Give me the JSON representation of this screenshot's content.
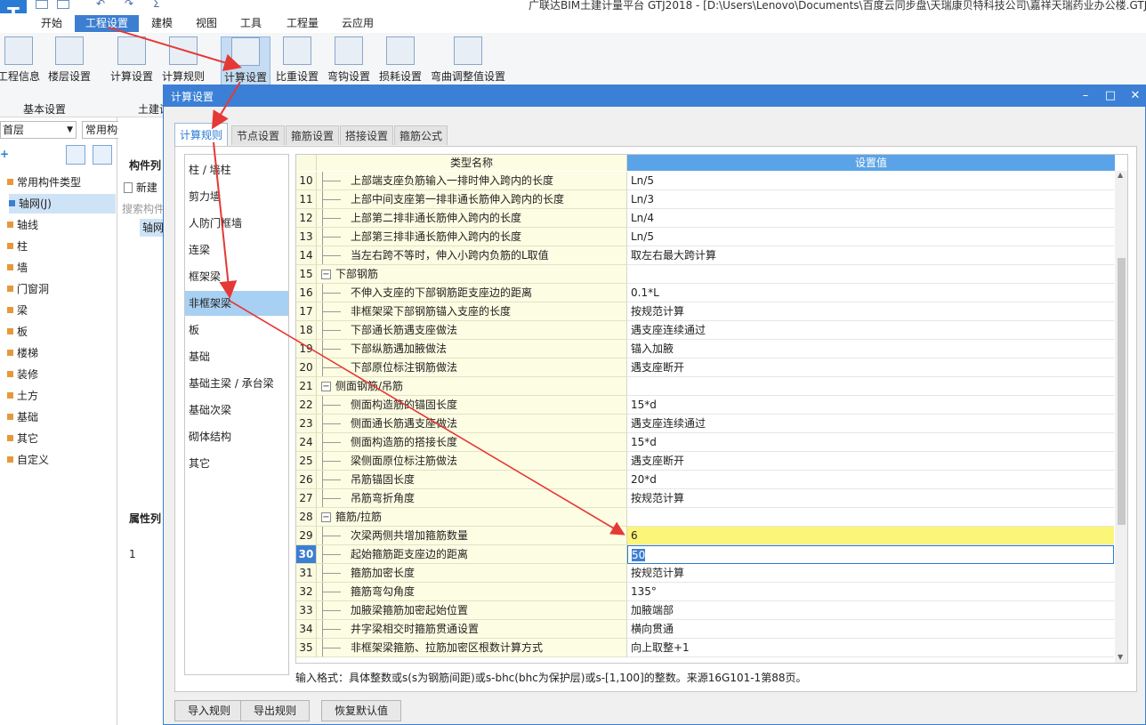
{
  "app_title": "广联达BIM土建计量平台 GTJ2018 - [D:\\Users\\Lenovo\\Documents\\百度云同步盘\\天瑞康贝特科技公司\\嘉祥天瑞药业办公楼.GTJ]",
  "menu_tabs": [
    "开始",
    "工程设置",
    "建模",
    "视图",
    "工具",
    "工程量",
    "云应用"
  ],
  "ribbon": {
    "buttons": [
      "工程信息",
      "楼层设置",
      "计算设置",
      "计算规则",
      "计算设置",
      "比重设置",
      "弯钩设置",
      "损耗设置",
      "弯曲调整值设置"
    ],
    "groups": [
      "基本设置",
      "土建设"
    ]
  },
  "left_pane": {
    "floor_select": "首层",
    "type_select": "常用构件类型",
    "tree": [
      "常用构件类型",
      "轴网(J)",
      "轴线",
      "柱",
      "墙",
      "门窗洞",
      "梁",
      "板",
      "楼梯",
      "装修",
      "土方",
      "基础",
      "其它",
      "自定义"
    ]
  },
  "mid_pane": {
    "title": "构件列",
    "new_label": "新建",
    "search_placeholder": "搜索构件",
    "item": "轴网",
    "props_title": "属性列",
    "props_row": "1"
  },
  "dialog": {
    "title": "计算设置",
    "tabs": [
      "计算规则",
      "节点设置",
      "箍筋设置",
      "搭接设置",
      "箍筋公式"
    ],
    "categories": [
      "柱 / 墙柱",
      "剪力墙",
      "人防门框墙",
      "连梁",
      "框架梁",
      "非框架梁",
      "板",
      "基础",
      "基础主梁 / 承台梁",
      "基础次梁",
      "砌体结构",
      "其它"
    ],
    "grid_headers": [
      "类型名称",
      "设置值"
    ],
    "rows": [
      {
        "no": "10",
        "name": "上部端支座负筋输入一排时伸入跨内的长度",
        "value": "Ln/5"
      },
      {
        "no": "11",
        "name": "上部中间支座第一排非通长筋伸入跨内的长度",
        "value": "Ln/3"
      },
      {
        "no": "12",
        "name": "上部第二排非通长筋伸入跨内的长度",
        "value": "Ln/4"
      },
      {
        "no": "13",
        "name": "上部第三排非通长筋伸入跨内的长度",
        "value": "Ln/5"
      },
      {
        "no": "14",
        "name": "当左右跨不等时，伸入小跨内负筋的L取值",
        "value": "取左右最大跨计算"
      },
      {
        "no": "15",
        "name": "下部钢筋",
        "value": "",
        "group": true
      },
      {
        "no": "16",
        "name": "不伸入支座的下部钢筋距支座边的距离",
        "value": "0.1*L"
      },
      {
        "no": "17",
        "name": "非框架梁下部钢筋锚入支座的长度",
        "value": "按规范计算"
      },
      {
        "no": "18",
        "name": "下部通长筋遇支座做法",
        "value": "遇支座连续通过"
      },
      {
        "no": "19",
        "name": "下部纵筋遇加腋做法",
        "value": "锚入加腋"
      },
      {
        "no": "20",
        "name": "下部原位标注钢筋做法",
        "value": "遇支座断开"
      },
      {
        "no": "21",
        "name": "侧面钢筋/吊筋",
        "value": "",
        "group": true
      },
      {
        "no": "22",
        "name": "侧面构造筋的锚固长度",
        "value": "15*d"
      },
      {
        "no": "23",
        "name": "侧面通长筋遇支座做法",
        "value": "遇支座连续通过"
      },
      {
        "no": "24",
        "name": "侧面构造筋的搭接长度",
        "value": "15*d"
      },
      {
        "no": "25",
        "name": "梁侧面原位标注筋做法",
        "value": "遇支座断开"
      },
      {
        "no": "26",
        "name": "吊筋锚固长度",
        "value": "20*d"
      },
      {
        "no": "27",
        "name": "吊筋弯折角度",
        "value": "按规范计算"
      },
      {
        "no": "28",
        "name": "箍筋/拉筋",
        "value": "",
        "group": true
      },
      {
        "no": "29",
        "name": "次梁两侧共增加箍筋数量",
        "value": "6",
        "highlight": true
      },
      {
        "no": "30",
        "name": "起始箍筋距支座边的距离",
        "value": "50",
        "current": true
      },
      {
        "no": "31",
        "name": "箍筋加密长度",
        "value": "按规范计算"
      },
      {
        "no": "32",
        "name": "箍筋弯勾角度",
        "value": "135°"
      },
      {
        "no": "33",
        "name": "加腋梁箍筋加密起始位置",
        "value": "加腋端部"
      },
      {
        "no": "34",
        "name": "井字梁相交时箍筋贯通设置",
        "value": "横向贯通"
      },
      {
        "no": "35",
        "name": "非框架梁箍筋、拉筋加密区根数计算方式",
        "value": "向上取整+1"
      }
    ],
    "hint": "输入格式：具体整数或s(s为钢筋间距)或s-bhc(bhc为保护层)或s-[1,100]的整数。来源16G101-1第88页。",
    "buttons": [
      "导入规则",
      "导出规则",
      "恢复默认值"
    ]
  },
  "colors": {
    "accent": "#3c7fd1",
    "highlight_row": "#fbf57a",
    "arrow": "#e53935",
    "name_cell": "#fdfde3"
  }
}
